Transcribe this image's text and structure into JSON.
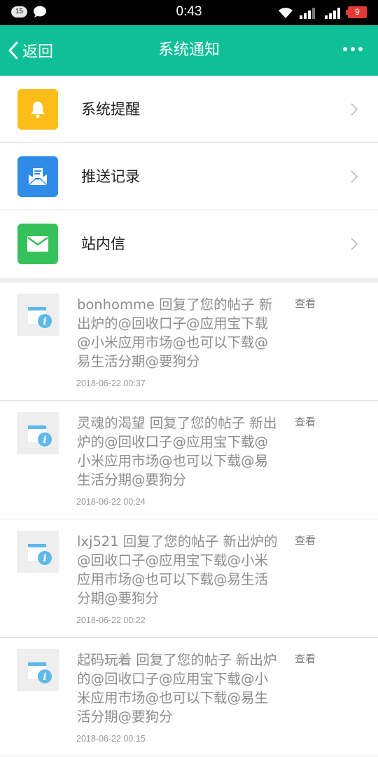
{
  "status_bar": {
    "notification_count": "15",
    "time": "0:43",
    "battery": "9",
    "icons": [
      "chat-bubble-icon",
      "wifi-icon",
      "signal-icon",
      "signal-icon"
    ]
  },
  "header": {
    "back_label": "返回",
    "title": "系统通知",
    "icons": [
      "chevron-left-icon",
      "more-icon"
    ],
    "background_color": "#0fbf97"
  },
  "categories": [
    {
      "label": "系统提醒",
      "icon": "bell-icon",
      "color": "#fcbc1a"
    },
    {
      "label": "推送记录",
      "icon": "envelope-open-icon",
      "color": "#2f8be6"
    },
    {
      "label": "站内信",
      "icon": "mail-icon",
      "color": "#36c25a"
    }
  ],
  "notifications": [
    {
      "text": "bonhomme 回复了您的帖子 新出炉的@回收口子@应用宝下载@小米应用市场@也可以下载@易生活分期@要狗分",
      "time": "2018-06-22 00:37",
      "action": "查看",
      "icon": "info-icon"
    },
    {
      "text": "灵魂的渴望 回复了您的帖子 新出炉的@回收口子@应用宝下载@小米应用市场@也可以下载@易生活分期@要狗分",
      "time": "2018-06-22 00:24",
      "action": "查看",
      "icon": "info-icon"
    },
    {
      "text": "lxj521 回复了您的帖子 新出炉的@回收口子@应用宝下载@小米应用市场@也可以下载@易生活分期@要狗分",
      "time": "2018-06-22 00:22",
      "action": "查看",
      "icon": "info-icon"
    },
    {
      "text": "起码玩着 回复了您的帖子 新出炉的@回收口子@应用宝下载@小米应用市场@也可以下载@易生活分期@要狗分",
      "time": "2018-06-22 00:15",
      "action": "查看",
      "icon": "info-icon"
    }
  ]
}
